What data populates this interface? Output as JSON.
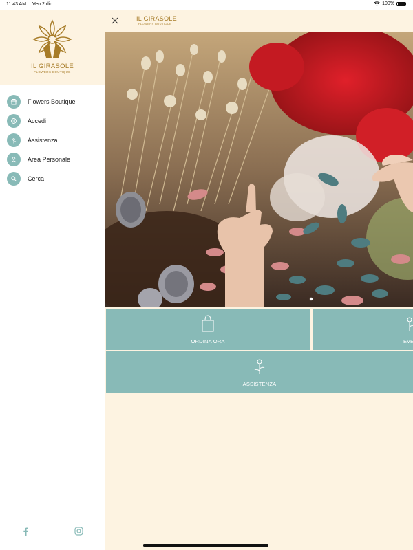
{
  "status": {
    "time": "11:43 AM",
    "date": "Ven 2 dic",
    "battery": "100%"
  },
  "brand": {
    "title": "IL GIRASOLE",
    "subtitle": "FLOWERS BOUTIQUE",
    "color": "#a77c28"
  },
  "sidebar": {
    "items": [
      {
        "label": "Flowers Boutique",
        "icon": "shop-icon"
      },
      {
        "label": "Accedi",
        "icon": "login-icon"
      },
      {
        "label": "Assistenza",
        "icon": "flower-icon"
      },
      {
        "label": "Area Personale",
        "icon": "user-icon"
      },
      {
        "label": "Cerca",
        "icon": "search-icon"
      }
    ],
    "footer": [
      "facebook-icon",
      "instagram-icon"
    ]
  },
  "header": {
    "title": "IL GIRASOLE",
    "subtitle": "FLOWERS BOUTIQUE"
  },
  "hero": {
    "alt": "dried-flowers-photo",
    "slides": 1,
    "active": 1
  },
  "tiles": [
    {
      "label": "ORDINA ORA",
      "icon": "bag-icon"
    },
    {
      "label": "EVE",
      "icon": "flower-icon"
    },
    {
      "label": "ASSISTENZA",
      "icon": "flower-icon"
    }
  ],
  "colors": {
    "accent": "#88bab7",
    "cream": "#fdf3e1"
  }
}
